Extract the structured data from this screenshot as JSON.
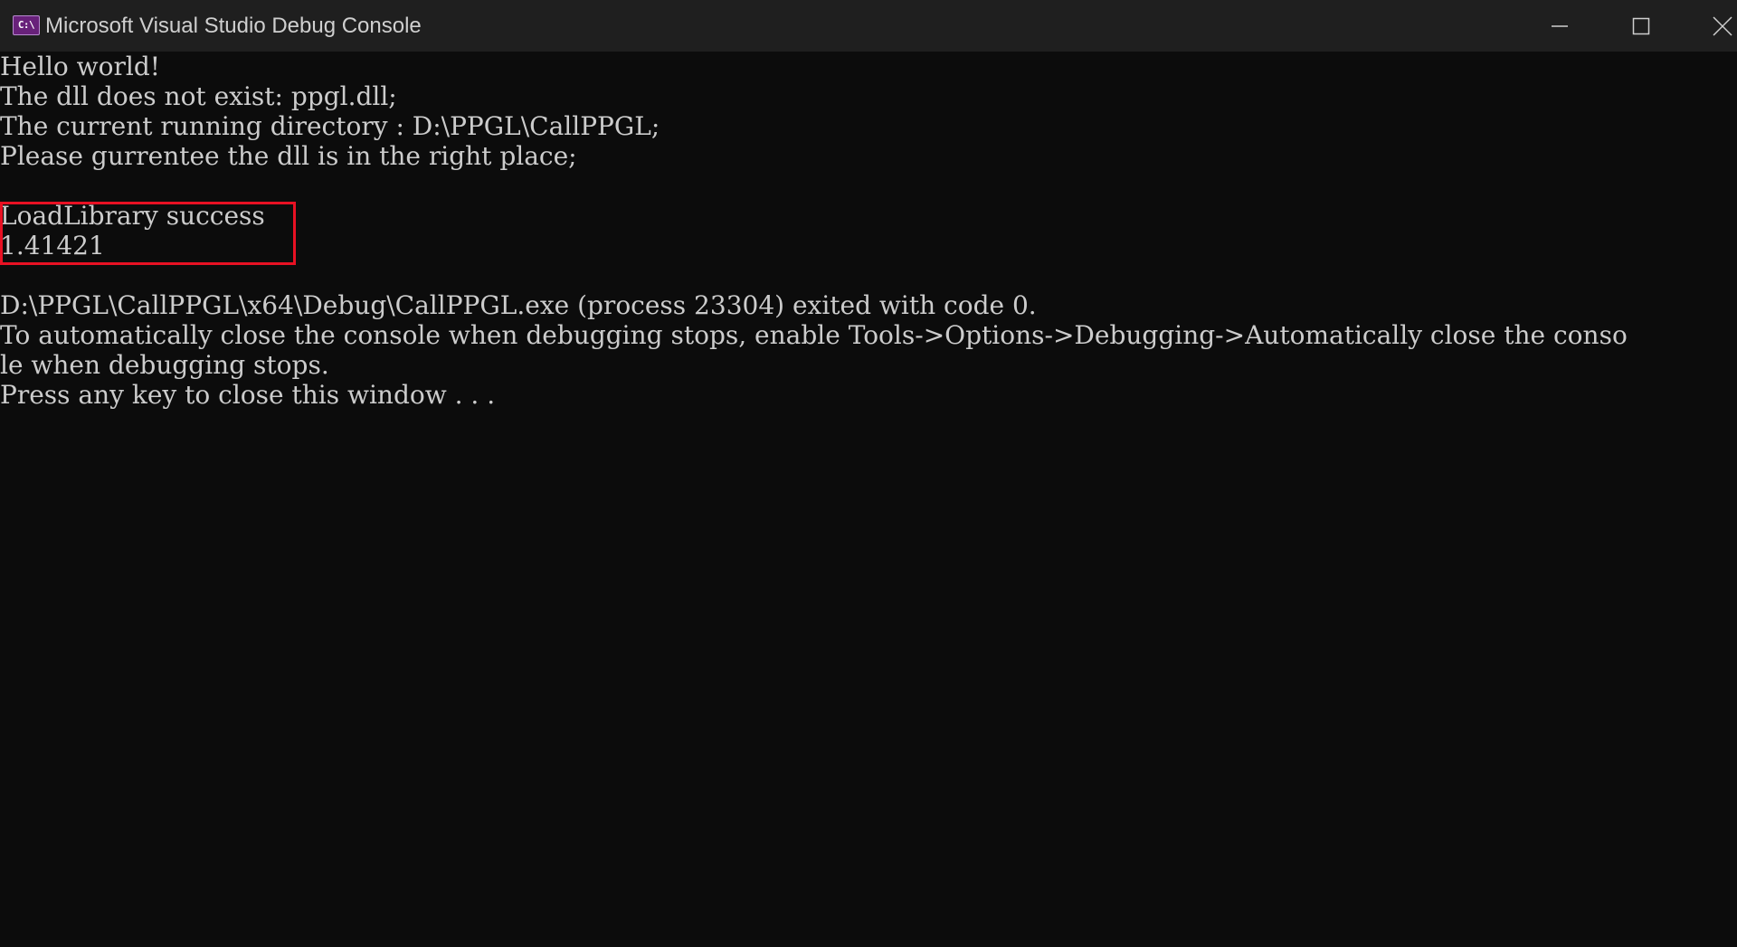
{
  "window": {
    "title": "Microsoft Visual Studio Debug Console",
    "icon": "console-app-icon",
    "icon_text": "C:\\",
    "controls": {
      "minimize": "minimize-icon",
      "maximize": "maximize-icon",
      "close": "close-icon"
    }
  },
  "console": {
    "lines": [
      "Hello world!",
      "The dll does not exist: ppgl.dll;",
      "The current running directory : D:\\PPGL\\CallPPGL;",
      "Please gurrentee the dll is in the right place;",
      "",
      "LoadLibrary success",
      "1.41421",
      "",
      "D:\\PPGL\\CallPPGL\\x64\\Debug\\CallPPGL.exe (process 23304) exited with code 0.",
      "To automatically close the console when debugging stops, enable Tools->Options->Debugging->Automatically close the conso",
      "le when debugging stops.",
      "Press any key to close this window . . ."
    ],
    "highlight_color": "#e81123",
    "text_color": "#cccccc",
    "background": "#0c0c0c"
  }
}
